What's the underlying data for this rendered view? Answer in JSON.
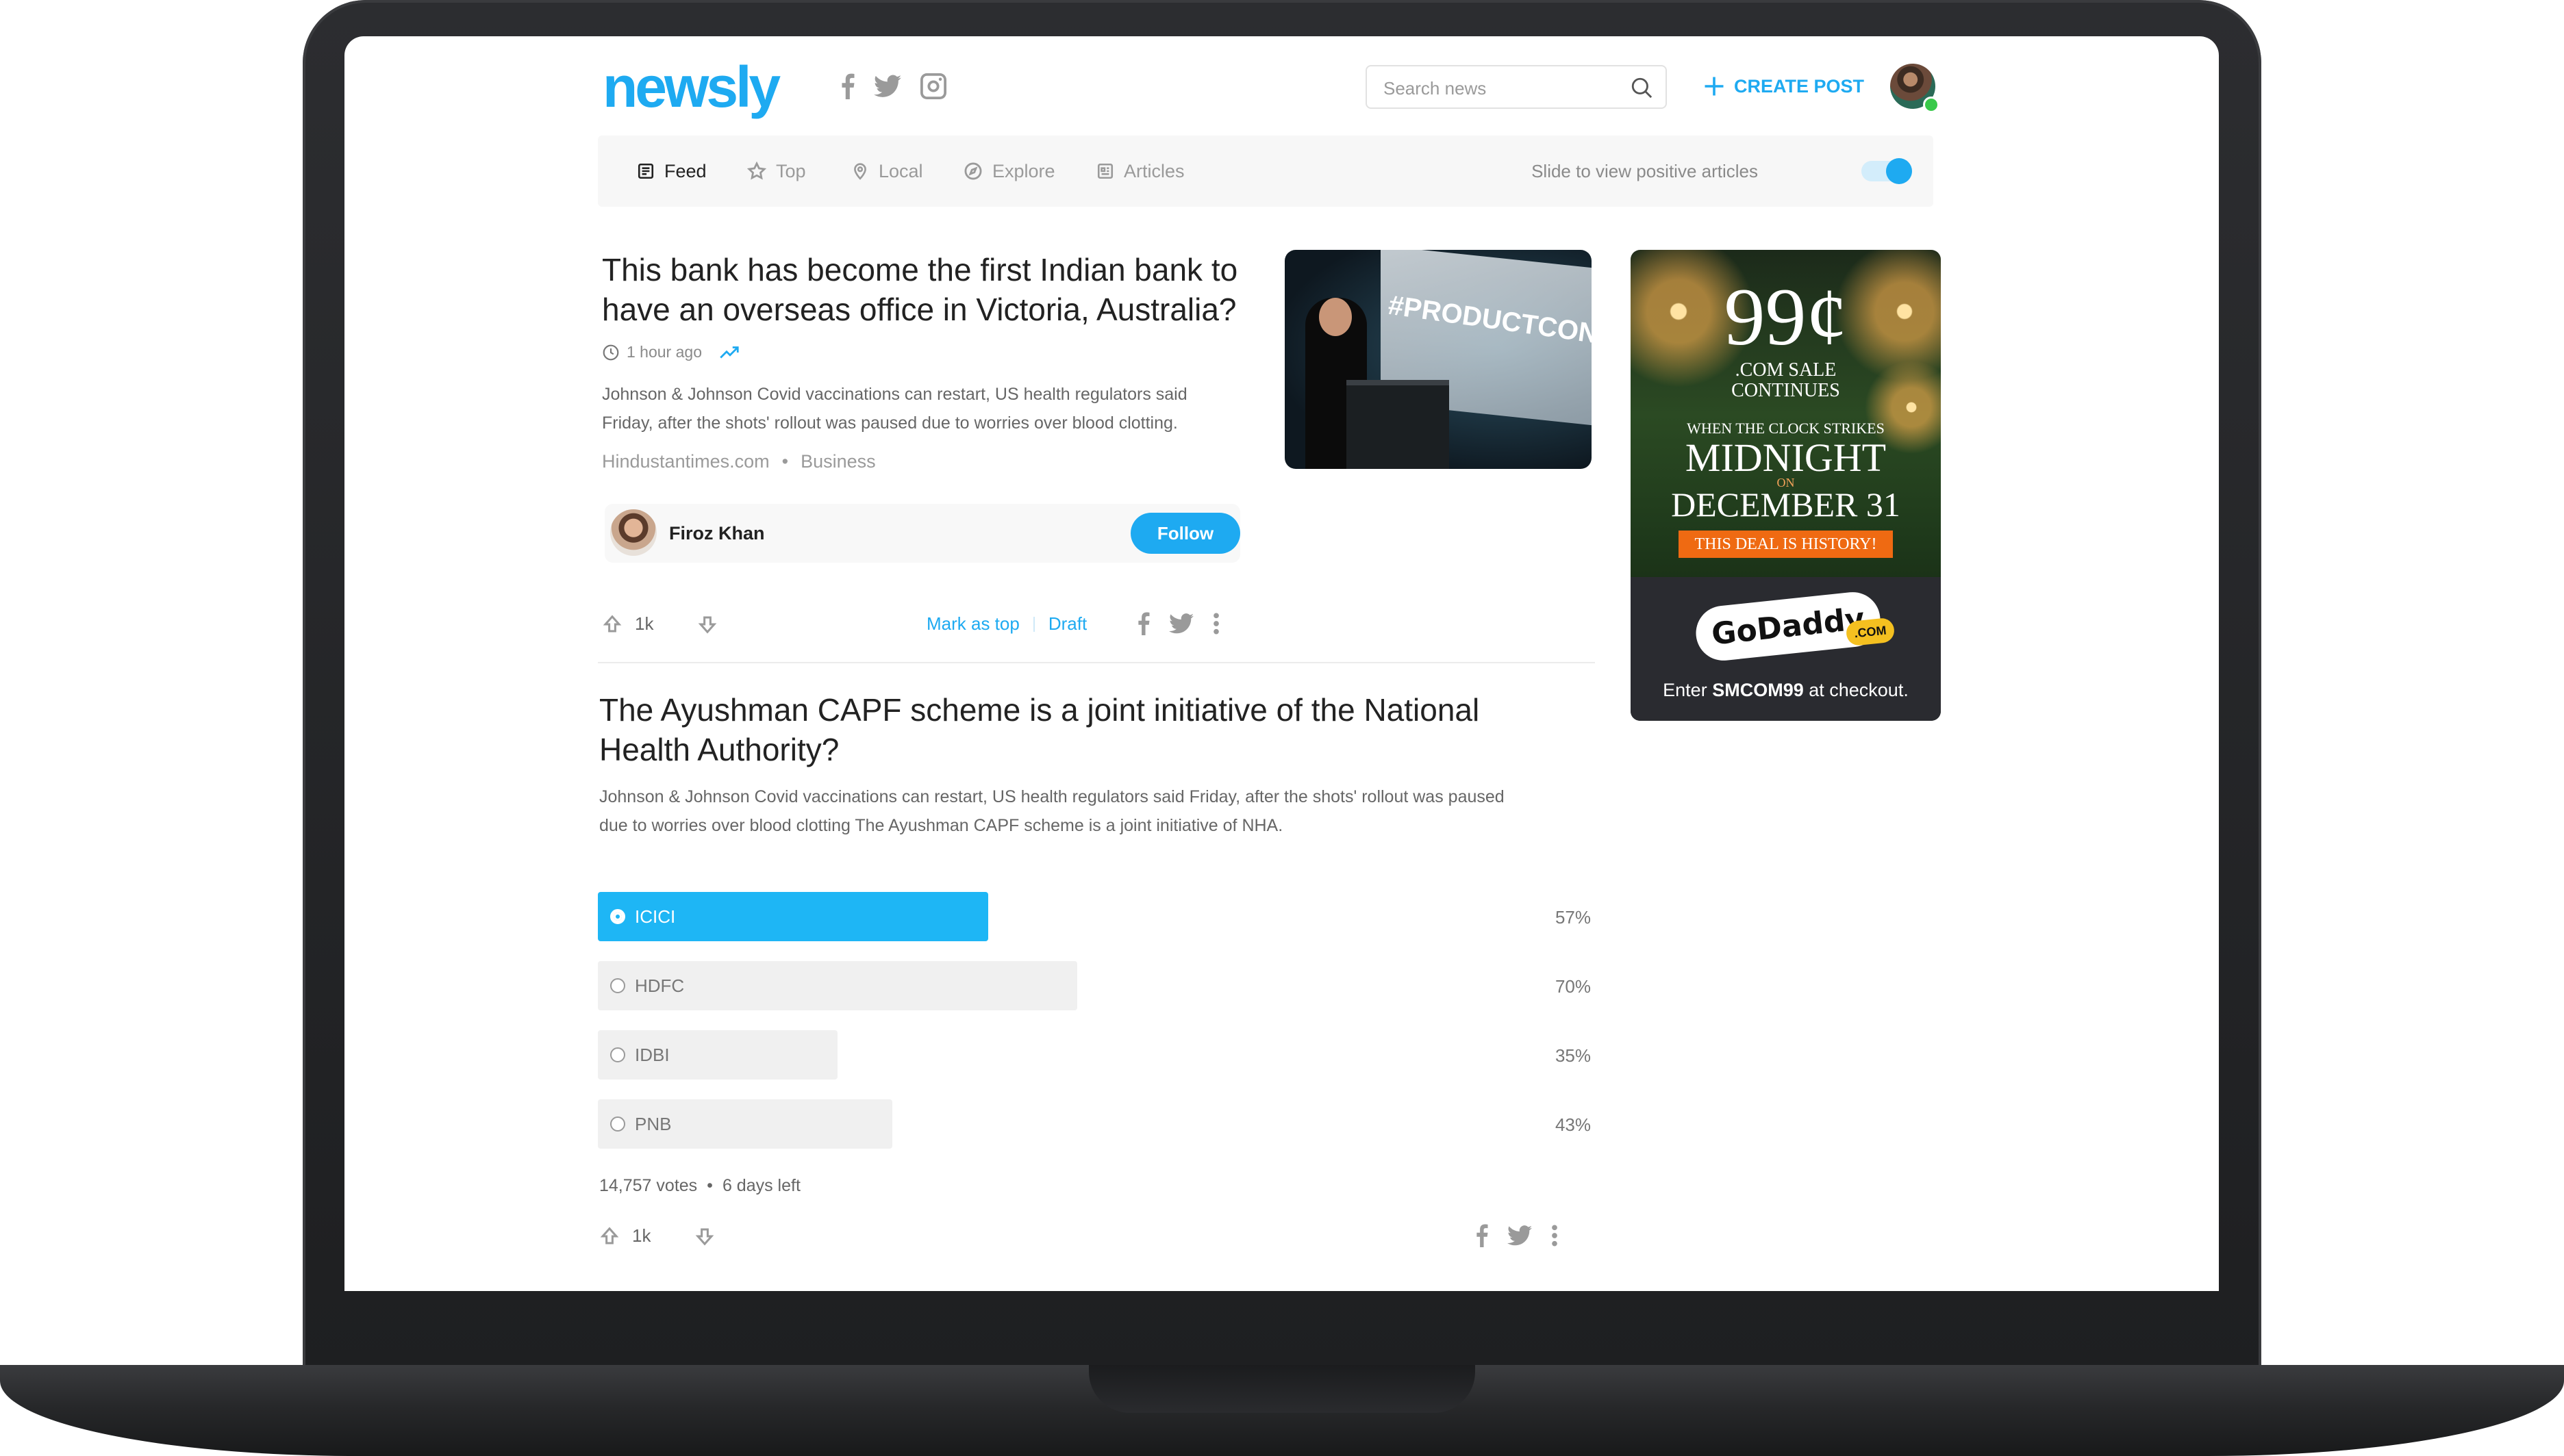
{
  "header": {
    "logo": "newsly",
    "search_placeholder": "Search news",
    "create_post_label": "CREATE POST"
  },
  "nav": {
    "items": [
      {
        "label": "Feed",
        "icon": "feed-icon",
        "active": true
      },
      {
        "label": "Top",
        "icon": "star-icon",
        "active": false
      },
      {
        "label": "Local",
        "icon": "location-pin-icon",
        "active": false
      },
      {
        "label": "Explore",
        "icon": "compass-icon",
        "active": false
      },
      {
        "label": "Articles",
        "icon": "articles-icon",
        "active": false
      }
    ],
    "toggle_label": "Slide to view positive articles",
    "toggle_on": true
  },
  "article": {
    "title_line1": "This bank has become the first Indian bank to",
    "title_line2": "have an overseas office in Victoria, Australia?",
    "time": "1 hour ago",
    "summary_line1": "Johnson & Johnson Covid vaccinations can restart, US health regulators said",
    "summary_line2": "Friday, after the shots' rollout was paused due to worries over blood clotting.",
    "source": "Hindustantimes.com",
    "category": "Business",
    "image_text": "#PRODUCTCON",
    "author": "Firoz Khan",
    "follow_label": "Follow",
    "upvotes": "1k",
    "mark_top_label": "Mark as top",
    "draft_label": "Draft"
  },
  "poll": {
    "title_line1": "The Ayushman CAPF scheme is a joint initiative of the National",
    "title_line2": "Health Authority?",
    "summary_line1": "Johnson & Johnson Covid vaccinations can restart, US health regulators said Friday, after the shots' rollout was paused",
    "summary_line2": "due to worries over blood clotting The Ayushman CAPF scheme is a joint initiative of NHA.",
    "options": [
      {
        "label": "ICICI",
        "pct": "57%",
        "fraction": 0.57,
        "selected": true
      },
      {
        "label": "HDFC",
        "pct": "70%",
        "fraction": 0.7,
        "selected": false
      },
      {
        "label": "IDBI",
        "pct": "35%",
        "fraction": 0.35,
        "selected": false
      },
      {
        "label": "PNB",
        "pct": "43%",
        "fraction": 0.43,
        "selected": false
      }
    ],
    "votes": "14,757 votes",
    "time_left": "6 days left",
    "upvotes": "1k"
  },
  "ad": {
    "price": "99¢",
    "line1": ".COM SALE",
    "line2": "CONTINUES",
    "line3": "WHEN THE CLOCK STRIKES",
    "line4": "MIDNIGHT",
    "line5": "ON",
    "line6": "DECEMBER 31",
    "ribbon": "THIS DEAL IS HISTORY!",
    "brand": "GoDaddy",
    "brand_suffix": ".COM",
    "promo_prefix": "Enter ",
    "promo_code": "SMCOM99",
    "promo_suffix": " at checkout."
  },
  "colors": {
    "accent": "#1eaaf1",
    "poll_selected": "#1eb6f5",
    "poll_track": "#f0f0f0",
    "online": "#39c94a",
    "ad_ribbon": "#ef6a12"
  }
}
